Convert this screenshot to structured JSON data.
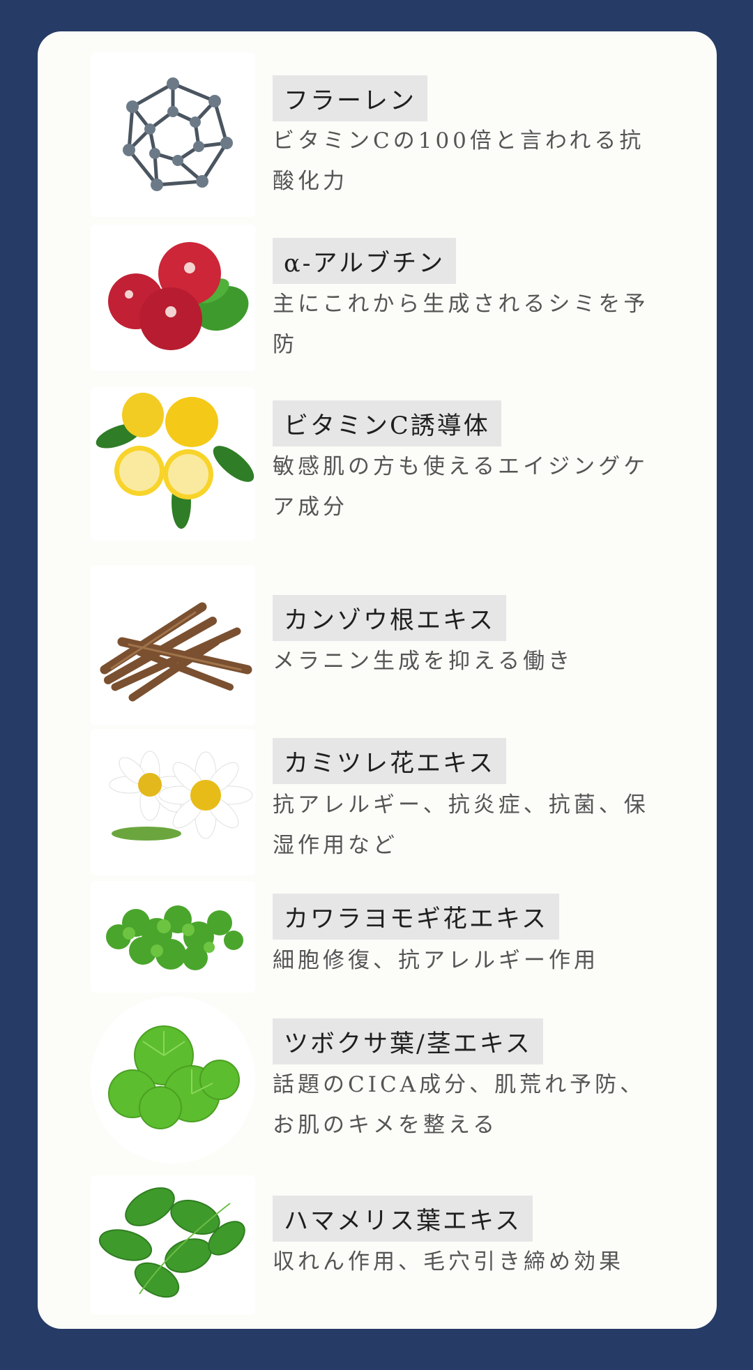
{
  "ingredients": [
    {
      "name": "フラーレン",
      "description": "ビタミンCの100倍と言われる抗酸化力",
      "image": "fullerene-molecule"
    },
    {
      "name": "α-アルブチン",
      "description": "主にこれから生成されるシミを予防",
      "image": "cranberry"
    },
    {
      "name": "ビタミンC誘導体",
      "description": "敏感肌の方も使えるエイジングケア成分",
      "image": "lemon"
    },
    {
      "name": "カンゾウ根エキス",
      "description": "メラニン生成を抑える働き",
      "image": "licorice-root"
    },
    {
      "name": "カミツレ花エキス",
      "description": "抗アレルギー、抗炎症、抗菌、保湿作用など",
      "image": "chamomile"
    },
    {
      "name": "カワラヨモギ花エキス",
      "description": "細胞修復、抗アレルギー作用",
      "image": "artemisia"
    },
    {
      "name": "ツボクサ葉/茎エキス",
      "description": "話題のCICA成分、肌荒れ予防、お肌のキメを整える",
      "image": "centella-leaves"
    },
    {
      "name": "ハマメリス葉エキス",
      "description": "収れん作用、毛穴引き締め効果",
      "image": "witch-hazel-leaves"
    }
  ]
}
